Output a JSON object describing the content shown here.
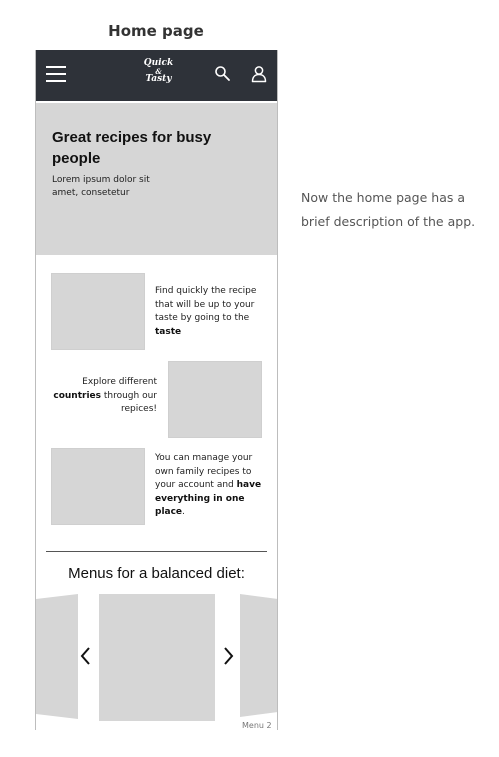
{
  "page_label": "Home page",
  "app": {
    "logo_lines": [
      "Quick",
      "&",
      "Tasty"
    ],
    "icons": {
      "menu": "hamburger-icon",
      "search": "search-icon",
      "account": "user-icon"
    },
    "colors": {
      "topbar": "#2e3239",
      "placeholder": "#d6d6d6"
    }
  },
  "hero": {
    "title": "Great recipes for busy people",
    "subtitle": "Lorem ipsum dolor sit amet, consetetur"
  },
  "features": [
    {
      "parts": [
        {
          "t": "Find quickly the recipe that will be up to your taste by going to the "
        },
        {
          "t": "taste",
          "b": true
        }
      ]
    },
    {
      "parts": [
        {
          "t": "Explore different "
        },
        {
          "t": "countries",
          "b": true
        },
        {
          "t": " through our repices!"
        }
      ]
    },
    {
      "parts": [
        {
          "t": "You can manage your own family recipes to your account and "
        },
        {
          "t": "have everything in one place",
          "b": true
        },
        {
          "t": "."
        }
      ]
    }
  ],
  "menus": {
    "title": "Menus for a balanced diet:",
    "next_label": "Menu 2"
  },
  "note": "Now the home page has a brief description of the app."
}
